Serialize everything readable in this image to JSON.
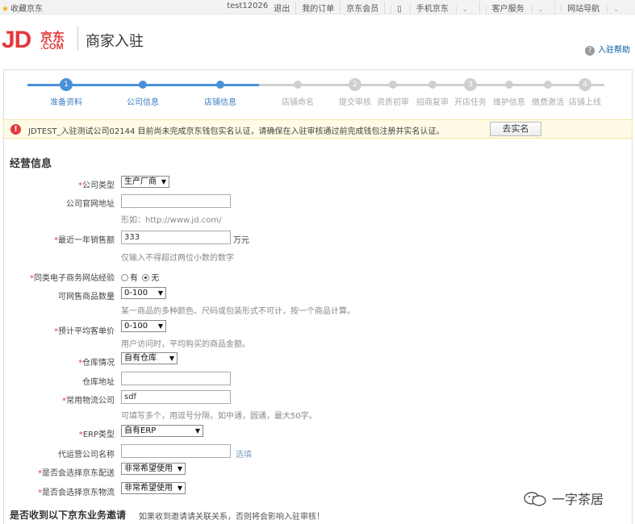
{
  "topbar": {
    "favorite": "收藏京东",
    "links": [
      "test12026",
      "退出",
      "我的订单",
      "京东会员",
      "手机京东",
      "客户服务",
      "网站导航"
    ]
  },
  "header": {
    "logo_jd": "JD",
    "logo_cn": "京东",
    "logo_com": ".COM",
    "title": "商家入驻",
    "help": "入驻帮助"
  },
  "steps": {
    "items": [
      {
        "label": "准备资料",
        "num": "1",
        "state": "done",
        "big": true
      },
      {
        "label": "公司信息",
        "num": "",
        "state": "done",
        "big": false
      },
      {
        "label": "店铺信息",
        "num": "",
        "state": "done",
        "big": false
      },
      {
        "label": "店铺命名",
        "num": "",
        "state": "todo",
        "big": false
      },
      {
        "label": "提交审核",
        "num": "2",
        "state": "todo",
        "big": true
      },
      {
        "label": "资质初审",
        "num": "",
        "state": "todo",
        "big": false
      },
      {
        "label": "招商复审",
        "num": "",
        "state": "todo",
        "big": false
      },
      {
        "label": "开店任务",
        "num": "3",
        "state": "todo",
        "big": true
      },
      {
        "label": "维护信息",
        "num": "",
        "state": "todo",
        "big": false
      },
      {
        "label": "缴费激活",
        "num": "",
        "state": "todo",
        "big": false
      },
      {
        "label": "店铺上线",
        "num": "4",
        "state": "todo",
        "big": true
      }
    ],
    "done_color": "#4a90d9",
    "todo_color": "#cfcfcf"
  },
  "notice": {
    "text": "JDTEST_入驻测试公司02144 目前尚未完成京东钱包实名认证，请确保在入驻审核通过前完成钱包注册并实名认证。",
    "button": "去实名"
  },
  "form": {
    "section_title": "经营信息",
    "company_type": {
      "label": "公司类型",
      "value": "生产厂商"
    },
    "website": {
      "label": "公司官网地址",
      "value": "",
      "hint": "形如：http://www.jd.com/"
    },
    "annual_sales": {
      "label": "最近一年销售额",
      "value": "333",
      "unit": "万元",
      "hint": "仅输入不得超过两位小数的数字"
    },
    "ecommerce_exp": {
      "label": "同类电子商务网站经验",
      "options": [
        "有",
        "无"
      ],
      "selected": "无"
    },
    "sku_count": {
      "label": "可网售商品数量",
      "value": "0-100",
      "hint": "某一商品的多种颜色、尺码或包装形式不可计，按一个商品计算。"
    },
    "avg_price": {
      "label": "预计平均客单价",
      "value": "0-100",
      "hint": "用户访问时，平均购买的商品金额。"
    },
    "warehouse": {
      "label": "仓库情况",
      "value": "自有仓库"
    },
    "warehouse_addr": {
      "label": "仓库地址",
      "value": ""
    },
    "logistics": {
      "label": "常用物流公司",
      "value": "sdf",
      "hint": "可填写多个，用逗号分隔，如中通，圆通，最大50字。"
    },
    "erp": {
      "label": "ERP类型",
      "value": "自有ERP"
    },
    "agent": {
      "label": "代运营公司名称",
      "value": "",
      "link": "选填"
    },
    "jd_delivery": {
      "label": "是否会选择京东配送",
      "value": "非常希望使用"
    },
    "jd_logistics": {
      "label": "是否会选择京东物流",
      "value": "非常希望使用"
    }
  },
  "bottom": {
    "title": "是否收到以下京东业务邀请",
    "note": "如果收到邀请请关联关系，否则将会影响入驻审核！"
  },
  "watermark": {
    "text": "一字茶居"
  }
}
